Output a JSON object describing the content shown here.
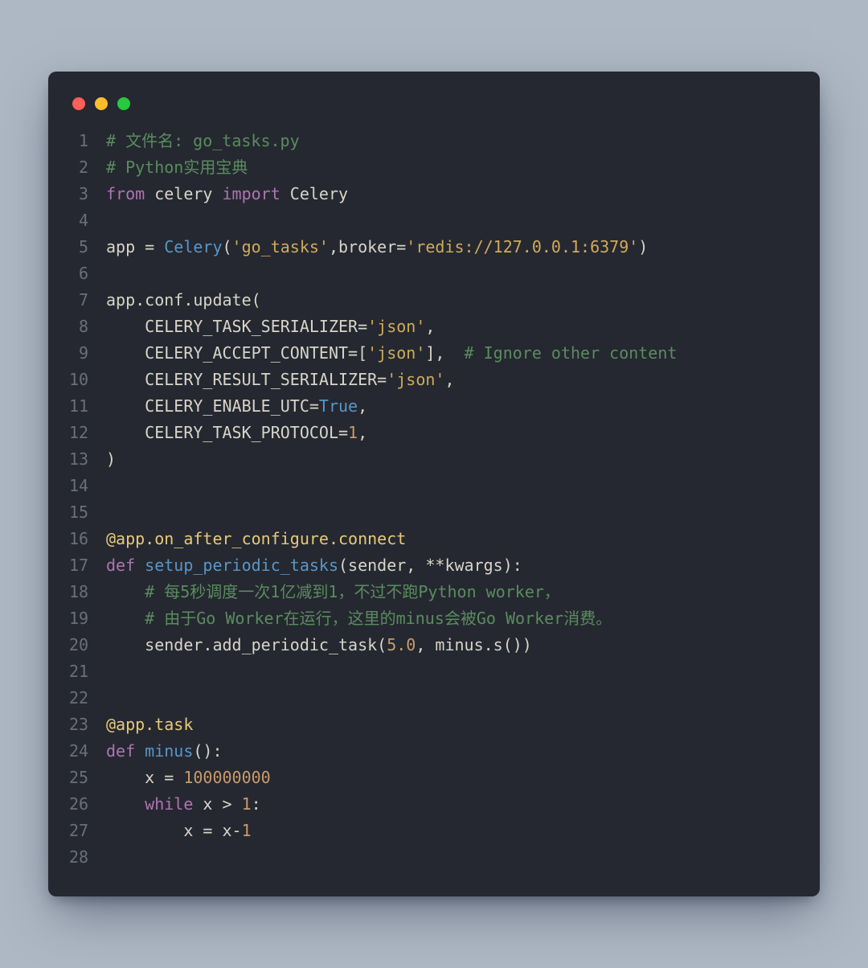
{
  "window": {
    "traffic_lights": [
      "close",
      "minimize",
      "zoom"
    ]
  },
  "code": {
    "lines": [
      {
        "n": 1,
        "tokens": [
          {
            "t": "# 文件名: go_tasks.py",
            "c": "com"
          }
        ]
      },
      {
        "n": 2,
        "tokens": [
          {
            "t": "# Python实用宝典",
            "c": "com"
          }
        ]
      },
      {
        "n": 3,
        "tokens": [
          {
            "t": "from",
            "c": "kw"
          },
          {
            "t": " celery ",
            "c": "nm"
          },
          {
            "t": "import",
            "c": "kw"
          },
          {
            "t": " Celery",
            "c": "nm"
          }
        ]
      },
      {
        "n": 4,
        "tokens": [
          {
            "t": "",
            "c": "nm"
          }
        ]
      },
      {
        "n": 5,
        "tokens": [
          {
            "t": "app = ",
            "c": "nm"
          },
          {
            "t": "Celery",
            "c": "bi"
          },
          {
            "t": "(",
            "c": "nm"
          },
          {
            "t": "'go_tasks'",
            "c": "str"
          },
          {
            "t": ",broker=",
            "c": "nm"
          },
          {
            "t": "'redis://127.0.0.1:6379'",
            "c": "str"
          },
          {
            "t": ")",
            "c": "nm"
          }
        ]
      },
      {
        "n": 6,
        "tokens": [
          {
            "t": "",
            "c": "nm"
          }
        ]
      },
      {
        "n": 7,
        "tokens": [
          {
            "t": "app.conf.update(",
            "c": "nm"
          }
        ]
      },
      {
        "n": 8,
        "tokens": [
          {
            "t": "    CELERY_TASK_SERIALIZER=",
            "c": "nm"
          },
          {
            "t": "'json'",
            "c": "str"
          },
          {
            "t": ",",
            "c": "nm"
          }
        ]
      },
      {
        "n": 9,
        "tokens": [
          {
            "t": "    CELERY_ACCEPT_CONTENT=[",
            "c": "nm"
          },
          {
            "t": "'json'",
            "c": "str"
          },
          {
            "t": "],  ",
            "c": "nm"
          },
          {
            "t": "# Ignore other content",
            "c": "com"
          }
        ]
      },
      {
        "n": 10,
        "tokens": [
          {
            "t": "    CELERY_RESULT_SERIALIZER=",
            "c": "nm"
          },
          {
            "t": "'json'",
            "c": "str"
          },
          {
            "t": ",",
            "c": "nm"
          }
        ]
      },
      {
        "n": 11,
        "tokens": [
          {
            "t": "    CELERY_ENABLE_UTC=",
            "c": "nm"
          },
          {
            "t": "True",
            "c": "bi"
          },
          {
            "t": ",",
            "c": "nm"
          }
        ]
      },
      {
        "n": 12,
        "tokens": [
          {
            "t": "    CELERY_TASK_PROTOCOL=",
            "c": "nm"
          },
          {
            "t": "1",
            "c": "num"
          },
          {
            "t": ",",
            "c": "nm"
          }
        ]
      },
      {
        "n": 13,
        "tokens": [
          {
            "t": ")",
            "c": "nm"
          }
        ]
      },
      {
        "n": 14,
        "tokens": [
          {
            "t": "",
            "c": "nm"
          }
        ]
      },
      {
        "n": 15,
        "tokens": [
          {
            "t": "",
            "c": "nm"
          }
        ]
      },
      {
        "n": 16,
        "tokens": [
          {
            "t": "@app.on_after_configure.connect",
            "c": "dec"
          }
        ]
      },
      {
        "n": 17,
        "tokens": [
          {
            "t": "def",
            "c": "kw"
          },
          {
            "t": " ",
            "c": "nm"
          },
          {
            "t": "setup_periodic_tasks",
            "c": "bi"
          },
          {
            "t": "(sender, **kwargs):",
            "c": "nm"
          }
        ]
      },
      {
        "n": 18,
        "tokens": [
          {
            "t": "    ",
            "c": "nm"
          },
          {
            "t": "# 每5秒调度一次1亿减到1，不过不跑Python worker，",
            "c": "com"
          }
        ]
      },
      {
        "n": 19,
        "tokens": [
          {
            "t": "    ",
            "c": "nm"
          },
          {
            "t": "# 由于Go Worker在运行，这里的minus会被Go Worker消费。",
            "c": "com"
          }
        ]
      },
      {
        "n": 20,
        "tokens": [
          {
            "t": "    sender.add_periodic_task(",
            "c": "nm"
          },
          {
            "t": "5.0",
            "c": "num"
          },
          {
            "t": ", minus.s())",
            "c": "nm"
          }
        ]
      },
      {
        "n": 21,
        "tokens": [
          {
            "t": "",
            "c": "nm"
          }
        ]
      },
      {
        "n": 22,
        "tokens": [
          {
            "t": "",
            "c": "nm"
          }
        ]
      },
      {
        "n": 23,
        "tokens": [
          {
            "t": "@app.task",
            "c": "dec"
          }
        ]
      },
      {
        "n": 24,
        "tokens": [
          {
            "t": "def",
            "c": "kw"
          },
          {
            "t": " ",
            "c": "nm"
          },
          {
            "t": "minus",
            "c": "bi"
          },
          {
            "t": "():",
            "c": "nm"
          }
        ]
      },
      {
        "n": 25,
        "tokens": [
          {
            "t": "    x = ",
            "c": "nm"
          },
          {
            "t": "100000000",
            "c": "num"
          }
        ]
      },
      {
        "n": 26,
        "tokens": [
          {
            "t": "    ",
            "c": "nm"
          },
          {
            "t": "while",
            "c": "kw"
          },
          {
            "t": " x > ",
            "c": "nm"
          },
          {
            "t": "1",
            "c": "num"
          },
          {
            "t": ":",
            "c": "nm"
          }
        ]
      },
      {
        "n": 27,
        "tokens": [
          {
            "t": "        x = x-",
            "c": "nm"
          },
          {
            "t": "1",
            "c": "num"
          }
        ]
      },
      {
        "n": 28,
        "tokens": [
          {
            "t": "",
            "c": "nm"
          }
        ]
      }
    ]
  }
}
